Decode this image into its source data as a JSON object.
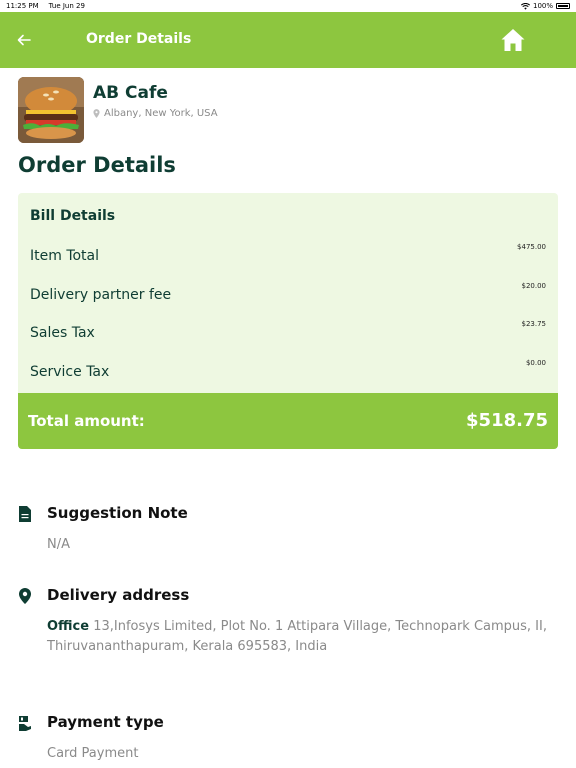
{
  "status_bar": {
    "time": "11:25 PM",
    "date": "Tue Jun 29",
    "battery": "100%"
  },
  "app_bar": {
    "title": "Order Details",
    "back_icon": "arrow-left-icon",
    "home_icon": "home-icon"
  },
  "restaurant": {
    "name": "AB Cafe",
    "location": "Albany, New York, USA"
  },
  "section_title": "Order Details",
  "bill": {
    "title": "Bill Details",
    "rows": [
      {
        "label": "Item Total",
        "amount": "$475.00"
      },
      {
        "label": "Delivery partner fee",
        "amount": "$20.00"
      },
      {
        "label": "Sales Tax",
        "amount": "$23.75"
      },
      {
        "label": "Service Tax",
        "amount": "$0.00"
      }
    ],
    "total_label": "Total amount:",
    "total_value": "$518.75"
  },
  "suggestion": {
    "title": "Suggestion Note",
    "value": "N/A"
  },
  "delivery": {
    "title": "Delivery address",
    "type": "Office",
    "address": " 13,Infosys Limited, Plot No. 1 Attipara Village, Technopark Campus, II, Thiruvananthapuram, Kerala 695583, India"
  },
  "payment": {
    "title": "Payment type",
    "value": "Card Payment"
  },
  "colors": {
    "accent": "#8dc63f",
    "light_accent": "#eef8e2",
    "text_dark": "#0f3d33",
    "muted": "#8a8a8a"
  }
}
